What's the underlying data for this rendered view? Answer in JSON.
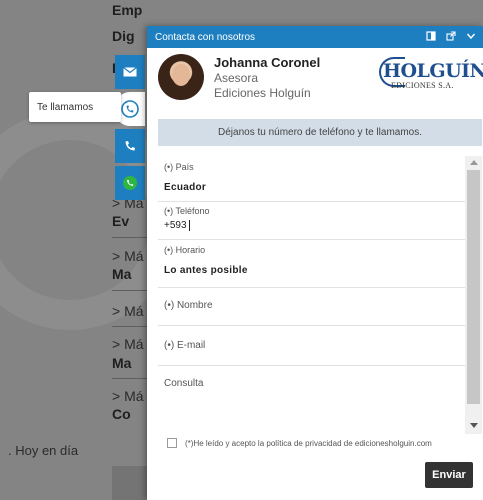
{
  "background": {
    "lines": [
      "Emp",
      "Dig",
      "Do",
      "Ev",
      "Ma",
      "Ma",
      "Co"
    ],
    "more": [
      "> Má",
      "> Má",
      "> Má",
      "> Má",
      "> Má"
    ],
    "hoy": ". Hoy en día"
  },
  "rail": {
    "mail_icon": "mail-icon",
    "call_icon": "callback-icon",
    "phone_icon": "phone-icon",
    "whatsapp_icon": "whatsapp-icon",
    "tooltip": "Te llamamos"
  },
  "panel": {
    "title": "Contacta con nosotros",
    "icons": [
      "minimize-icon",
      "popout-icon",
      "chevron-down-icon"
    ],
    "agent": {
      "name": "Johanna Coronel",
      "role": "Asesora",
      "company": "Ediciones Holguín"
    },
    "logo": {
      "main": "HOLGUÍN",
      "sub": "EDICIONES S.A."
    },
    "banner": "Déjanos tu número de teléfono y te llamamos.",
    "form": {
      "pais_label": "(•) País",
      "pais_value": "Ecuador",
      "telefono_label": "(•) Teléfono",
      "telefono_value": "+593",
      "horario_label": "(•) Horario",
      "horario_value": "Lo antes posible",
      "nombre_label": "(•) Nombre",
      "email_label": "(•) E-mail",
      "consulta_label": "Consulta"
    },
    "privacy": "(*)He leído y acepto la política de privacidad de edicionesholguin.com",
    "send": "Enviar"
  },
  "colors": {
    "accent": "#1e7fc0",
    "banner": "#d3dde8",
    "send": "#333333"
  }
}
